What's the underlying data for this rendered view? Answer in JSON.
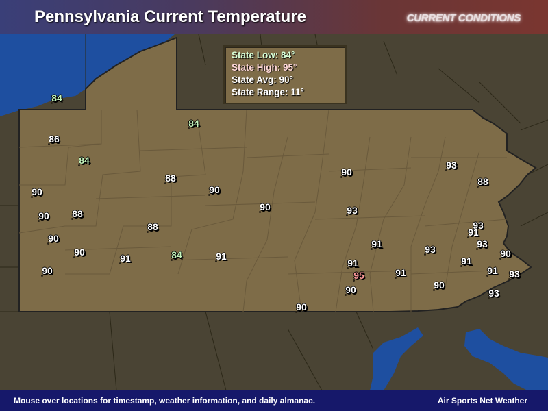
{
  "header": {
    "title": "Pennsylvania Current Temperature",
    "badge": "CURRENT CONDITIONS"
  },
  "stats": {
    "low": "State Low: 84°",
    "high": "State High: 95°",
    "avg": "State Avg: 90°",
    "range": "State Range: 11°"
  },
  "temperatures": [
    {
      "value": "84",
      "kind": "low"
    },
    {
      "value": "84",
      "kind": "low"
    },
    {
      "value": "86",
      "kind": "normal"
    },
    {
      "value": "84",
      "kind": "low"
    },
    {
      "value": "90",
      "kind": "normal"
    },
    {
      "value": "88",
      "kind": "normal"
    },
    {
      "value": "90",
      "kind": "normal"
    },
    {
      "value": "90",
      "kind": "normal"
    },
    {
      "value": "90",
      "kind": "normal"
    },
    {
      "value": "88",
      "kind": "normal"
    },
    {
      "value": "88",
      "kind": "normal"
    },
    {
      "value": "90",
      "kind": "normal"
    },
    {
      "value": "90",
      "kind": "normal"
    },
    {
      "value": "91",
      "kind": "normal"
    },
    {
      "value": "84",
      "kind": "low"
    },
    {
      "value": "91",
      "kind": "normal"
    },
    {
      "value": "90",
      "kind": "normal"
    },
    {
      "value": "90",
      "kind": "normal"
    },
    {
      "value": "93",
      "kind": "normal"
    },
    {
      "value": "93",
      "kind": "normal"
    },
    {
      "value": "88",
      "kind": "normal"
    },
    {
      "value": "93",
      "kind": "normal"
    },
    {
      "value": "91",
      "kind": "normal"
    },
    {
      "value": "93",
      "kind": "normal"
    },
    {
      "value": "91",
      "kind": "normal"
    },
    {
      "value": "93",
      "kind": "normal"
    },
    {
      "value": "90",
      "kind": "normal"
    },
    {
      "value": "91",
      "kind": "normal"
    },
    {
      "value": "91",
      "kind": "normal"
    },
    {
      "value": "95",
      "kind": "high"
    },
    {
      "value": "91",
      "kind": "normal"
    },
    {
      "value": "90",
      "kind": "normal"
    },
    {
      "value": "91",
      "kind": "normal"
    },
    {
      "value": "93",
      "kind": "normal"
    },
    {
      "value": "90",
      "kind": "normal"
    },
    {
      "value": "93",
      "kind": "normal"
    },
    {
      "value": "90",
      "kind": "normal"
    }
  ],
  "footer": {
    "left": "Mouse over locations for timestamp, weather information, and daily almanac.",
    "right": "Air Sports Net Weather"
  },
  "colors": {
    "land": "#7e6c48",
    "surrounding": "#4a4434",
    "water": "#1e4fa0",
    "footer": "#16186a"
  }
}
